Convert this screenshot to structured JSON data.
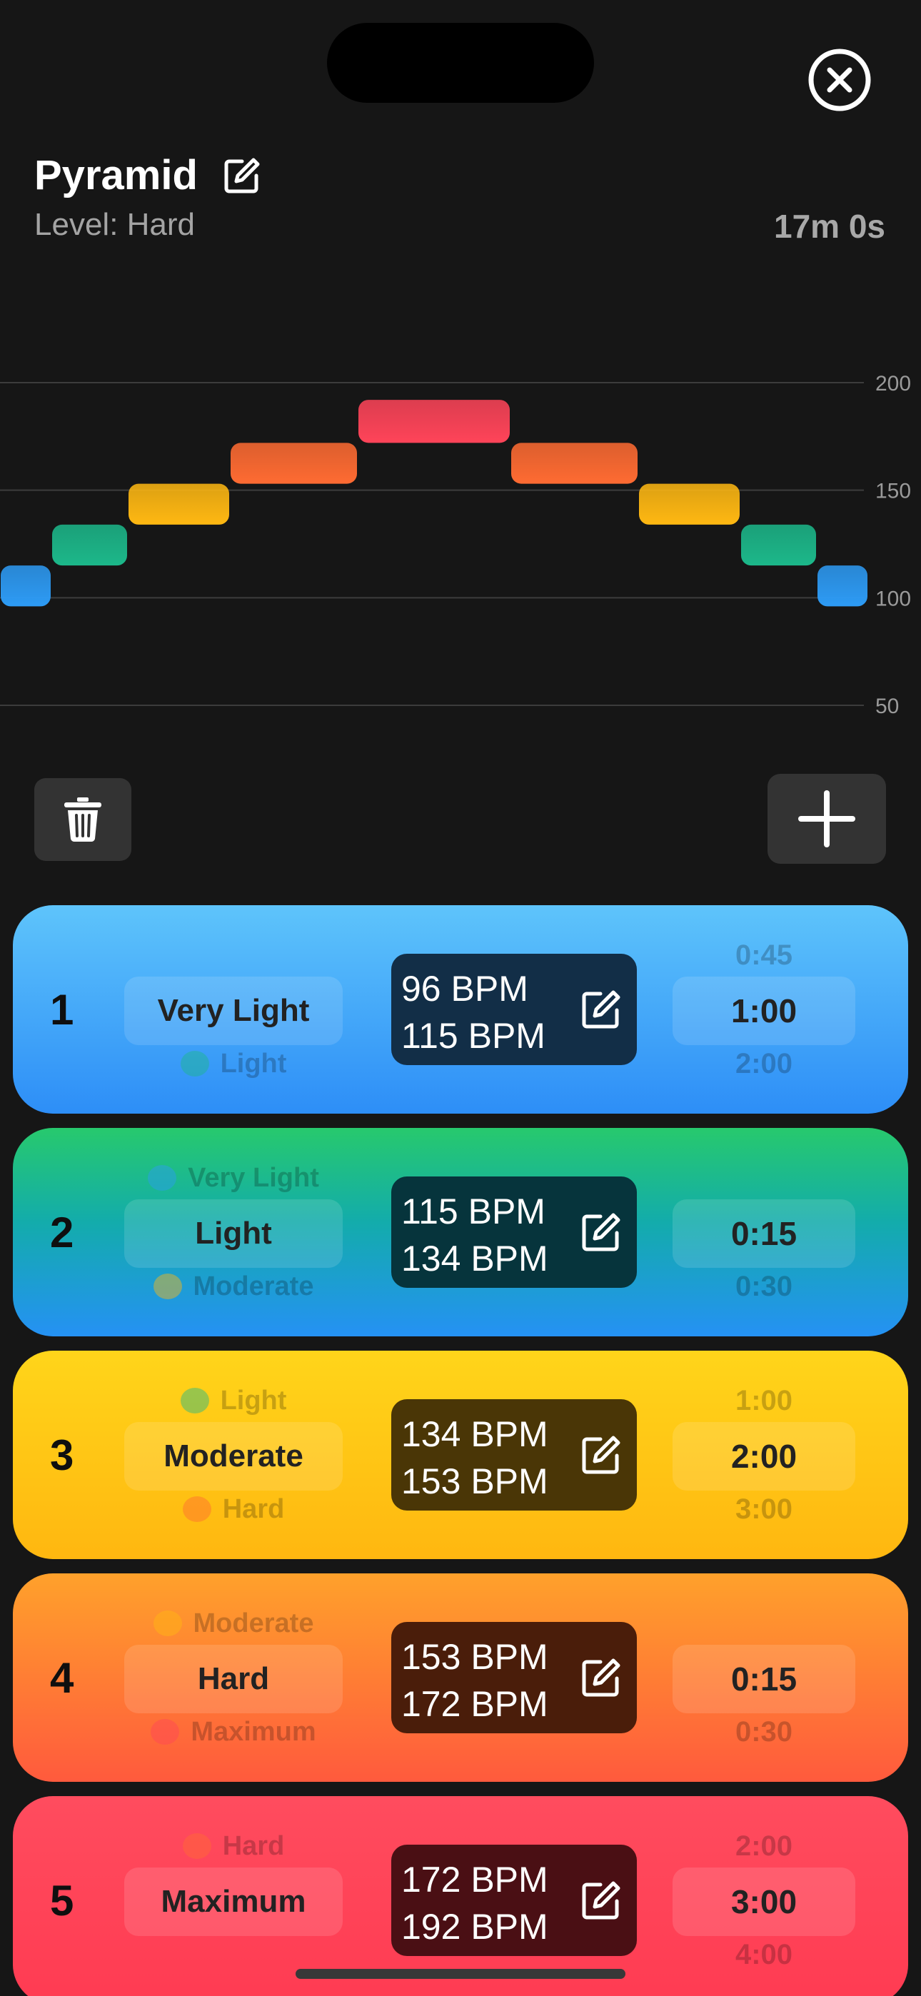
{
  "header": {
    "workout_title": "Pyramid",
    "level_text": "Level: Hard",
    "duration_text": "17m 0s"
  },
  "chart_data": {
    "type": "bar",
    "y_axis_ticks": [
      "200",
      "150",
      "100",
      "50"
    ],
    "ylim": [
      50,
      200
    ],
    "grid": true,
    "segments": [
      {
        "zone": "Very Light",
        "bpm_low": 96,
        "bpm_high": 115,
        "color": "#2d9bf5"
      },
      {
        "zone": "Light",
        "bpm_low": 115,
        "bpm_high": 134,
        "color": "#1cb88a"
      },
      {
        "zone": "Moderate",
        "bpm_low": 134,
        "bpm_high": 153,
        "color": "#ffb812"
      },
      {
        "zone": "Hard",
        "bpm_low": 153,
        "bpm_high": 172,
        "color": "#ff6b32"
      },
      {
        "zone": "Maximum",
        "bpm_low": 172,
        "bpm_high": 192,
        "color": "#ff4459"
      },
      {
        "zone": "Hard",
        "bpm_low": 153,
        "bpm_high": 172,
        "color": "#ff6b32"
      },
      {
        "zone": "Moderate",
        "bpm_low": 134,
        "bpm_high": 153,
        "color": "#ffb812"
      },
      {
        "zone": "Light",
        "bpm_low": 115,
        "bpm_high": 134,
        "color": "#1cb88a"
      },
      {
        "zone": "Very Light",
        "bpm_low": 96,
        "bpm_high": 115,
        "color": "#2d9bf5"
      }
    ]
  },
  "toolbar": {
    "delete_icon": "trash-icon",
    "add_icon": "plus-icon"
  },
  "intervals": [
    {
      "number": "1",
      "zone_above": "",
      "zone": "Very Light",
      "zone_below": "Light",
      "bpm_low": "96 BPM",
      "bpm_high": "115 BPM",
      "time_above": "0:45",
      "time": "1:00",
      "time_below": "2:00",
      "dot_below_color": "#1cb88a"
    },
    {
      "number": "2",
      "zone_above": "Very Light",
      "zone": "Light",
      "zone_below": "Moderate",
      "bpm_low": "115 BPM",
      "bpm_high": "134 BPM",
      "time_above": "",
      "time": "0:15",
      "time_below": "0:30",
      "dot_above_color": "#2d9bf5",
      "dot_below_color": "#ffb812"
    },
    {
      "number": "3",
      "zone_above": "Light",
      "zone": "Moderate",
      "zone_below": "Hard",
      "bpm_low": "134 BPM",
      "bpm_high": "153 BPM",
      "time_above": "1:00",
      "time": "2:00",
      "time_below": "3:00",
      "dot_above_color": "#1cb88a",
      "dot_below_color": "#ff6b32"
    },
    {
      "number": "4",
      "zone_above": "Moderate",
      "zone": "Hard",
      "zone_below": "Maximum",
      "bpm_low": "153 BPM",
      "bpm_high": "172 BPM",
      "time_above": "",
      "time": "0:15",
      "time_below": "0:30",
      "dot_above_color": "#ffb812",
      "dot_below_color": "#ff4459"
    },
    {
      "number": "5",
      "zone_above": "Hard",
      "zone": "Maximum",
      "zone_below": "",
      "bpm_low": "172 BPM",
      "bpm_high": "192 BPM",
      "time_above": "2:00",
      "time": "3:00",
      "time_below": "4:00",
      "dot_above_color": "#ff6b32"
    }
  ]
}
